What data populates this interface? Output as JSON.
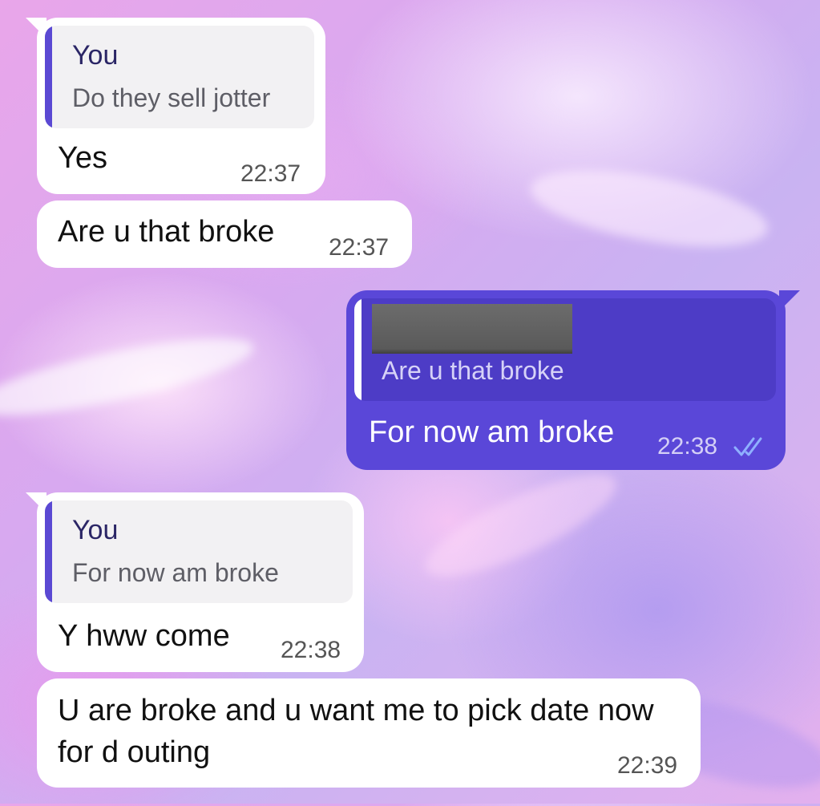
{
  "colors": {
    "incoming_bubble": "#ffffff",
    "outgoing_bubble": "#5a47d8",
    "reply_accent": "#5b49d3",
    "read_ticks": "#8fb0ff"
  },
  "messages": [
    {
      "direction": "incoming",
      "reply": {
        "name": "You",
        "text": "Do they sell jotter"
      },
      "text": "Yes",
      "time": "22:37"
    },
    {
      "direction": "incoming",
      "text": "Are u that broke",
      "time": "22:37"
    },
    {
      "direction": "outgoing",
      "reply": {
        "name_redacted": true,
        "text": "Are u that broke"
      },
      "text": "For now am broke",
      "time": "22:38",
      "status_icon": "double-check-read-icon"
    },
    {
      "direction": "incoming",
      "reply": {
        "name": "You",
        "text": "For now am broke"
      },
      "text": "Y hww come",
      "time": "22:38"
    },
    {
      "direction": "incoming",
      "text": "U are broke and u want me to pick date now for d outing",
      "time": "22:39"
    }
  ]
}
